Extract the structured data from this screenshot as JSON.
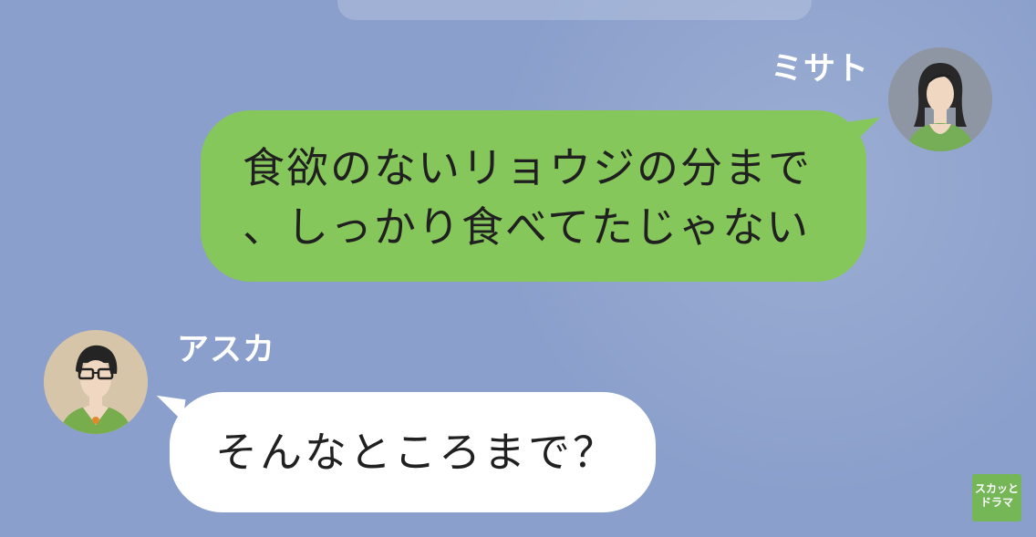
{
  "chat": {
    "messages": [
      {
        "sender": "ミサト",
        "side": "right",
        "lines": [
          "食欲のないリョウジの分まで",
          "、しっかり食べてたじゃない"
        ]
      },
      {
        "sender": "アスカ",
        "side": "left",
        "lines": [
          "そんなところまで？"
        ]
      }
    ]
  },
  "colors": {
    "background": "#8a9fcb",
    "sent_bubble": "#86c75b",
    "received_bubble": "#ffffff",
    "watermark": "#75b657"
  },
  "watermark": {
    "line1": "スカッと",
    "line2": "ドラマ"
  }
}
